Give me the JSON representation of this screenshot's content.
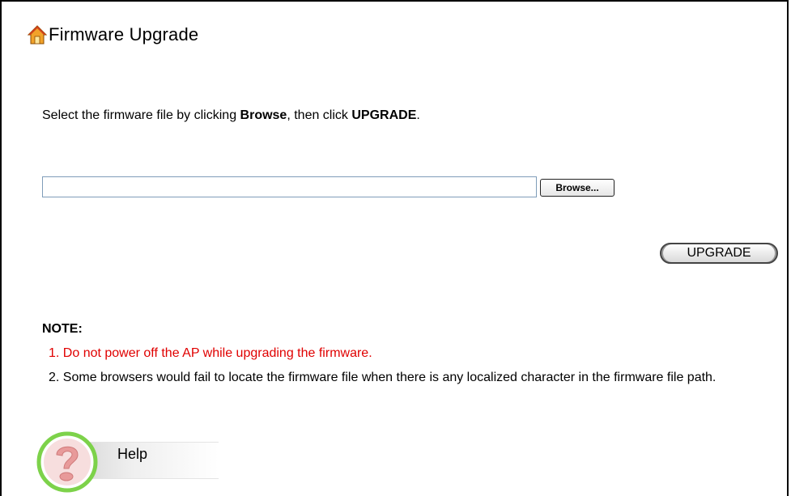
{
  "page": {
    "title": "Firmware Upgrade",
    "title_icon": "home-icon"
  },
  "instruction": {
    "prefix": "Select the firmware file by clicking ",
    "browse_word": "Browse",
    "middle": ", then click ",
    "upgrade_word": "UPGRADE",
    "suffix": "."
  },
  "file_picker": {
    "value": "",
    "placeholder": "",
    "browse_label": "Browse..."
  },
  "actions": {
    "upgrade_label": "UPGRADE"
  },
  "notes": {
    "heading": "NOTE:",
    "items": [
      "1. Do not power off the AP while upgrading the firmware.",
      "2. Some browsers would fail to locate the firmware file when there is any localized character in the firmware file path."
    ],
    "warning_color": "#e00000"
  },
  "help": {
    "label": "Help",
    "icon": "question-mark-icon",
    "ring_color": "#7dd24a",
    "icon_color": "#e89a9a"
  }
}
